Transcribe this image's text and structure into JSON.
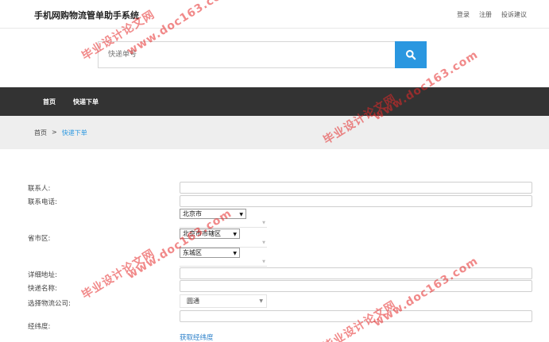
{
  "header": {
    "site_title": "手机网购物流管单助手系统",
    "links": [
      "登录",
      "注册",
      "投诉建议"
    ]
  },
  "search": {
    "placeholder": "快递单号"
  },
  "nav": {
    "items": [
      "首页",
      "快递下单"
    ]
  },
  "breadcrumb": {
    "home": "首页",
    "separator": ">",
    "current": "快递下单"
  },
  "form": {
    "contact_label": "联系人:",
    "phone_label": "联系电话:",
    "region_label": "省市区:",
    "province": "北京市",
    "city": "北京市市辖区",
    "district": "东城区",
    "address_label": "详细地址:",
    "express_name_label": "快递名称:",
    "company_label": "选择物流公司:",
    "company_value": "圆通",
    "latlng_label": "经纬度:",
    "get_latlng_link": "获取经纬度"
  },
  "watermarks": [
    "毕业设计论文网",
    "www.doc163.com"
  ],
  "colors": {
    "accent": "#2a97e0",
    "nav_bg": "#333333",
    "crumb_bg": "#eeeeee",
    "watermark": "#e62828"
  }
}
